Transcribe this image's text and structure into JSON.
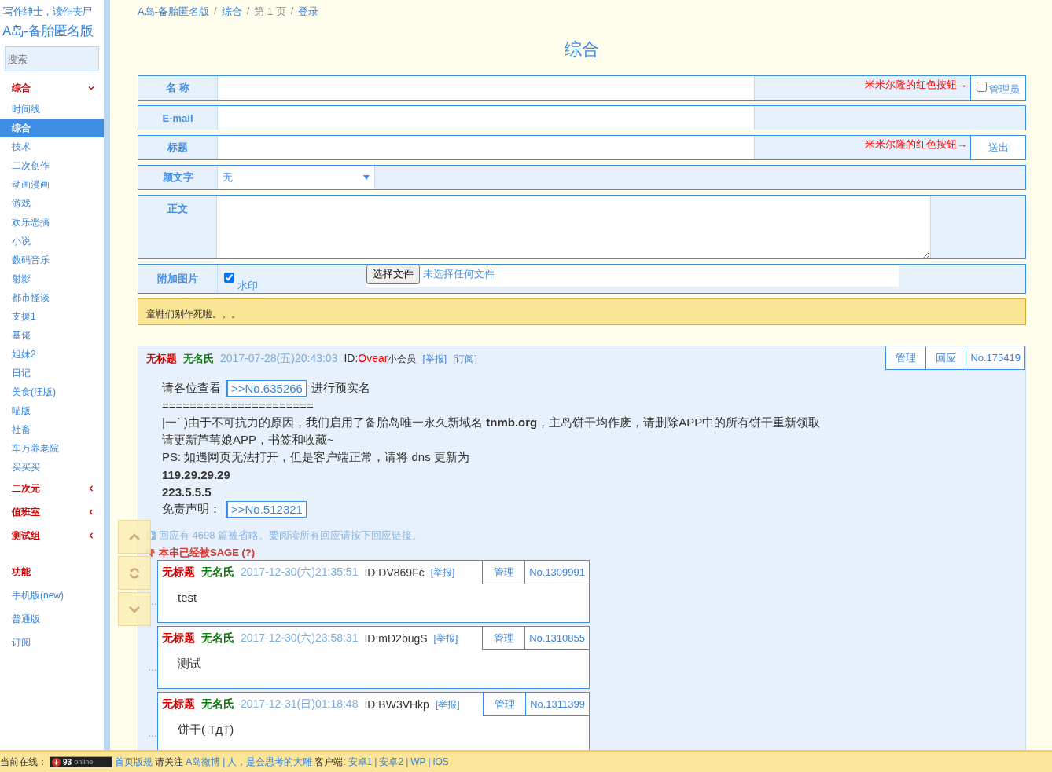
{
  "sidebar": {
    "slogan": "写作绅士，读作丧尸",
    "site_title": "A岛-备胎匿名版",
    "search": {
      "placeholder": "搜索"
    },
    "groups": [
      {
        "label": "综合",
        "expanded": true,
        "items": [
          {
            "label": "时间线",
            "selected": false
          },
          {
            "label": "综合",
            "selected": true
          },
          {
            "label": "技术",
            "selected": false
          },
          {
            "label": "二次创作",
            "selected": false
          },
          {
            "label": "动画漫画",
            "selected": false
          },
          {
            "label": "游戏",
            "selected": false
          },
          {
            "label": "欢乐恶搞",
            "selected": false
          },
          {
            "label": "小说",
            "selected": false
          },
          {
            "label": "数码音乐",
            "selected": false
          },
          {
            "label": "射影",
            "selected": false
          },
          {
            "label": "都市怪谈",
            "selected": false
          },
          {
            "label": "支援1",
            "selected": false
          },
          {
            "label": "基佬",
            "selected": false
          },
          {
            "label": "姐妹2",
            "selected": false
          },
          {
            "label": "日记",
            "selected": false
          },
          {
            "label": "美食(汪版)",
            "selected": false
          },
          {
            "label": "喵版",
            "selected": false
          },
          {
            "label": "社畜",
            "selected": false
          },
          {
            "label": "车万养老院",
            "selected": false
          },
          {
            "label": "买买买",
            "selected": false
          }
        ]
      },
      {
        "label": "二次元",
        "expanded": false
      },
      {
        "label": "值班室",
        "expanded": false
      },
      {
        "label": "测试组",
        "expanded": false
      }
    ],
    "functions": {
      "label": "功能",
      "items": [
        "手机版(new)",
        "普通版",
        "订阅"
      ]
    }
  },
  "breadcrumb": [
    "A岛-备胎匿名版",
    "综合",
    "第 1 页",
    "登录"
  ],
  "breadcrumb_separator": "/",
  "page_title": "综合",
  "form": {
    "name_label": "名 称",
    "email_label": "E-mail",
    "title_label": "标题",
    "red_button_hint": "米米尔隆的红色按钮→",
    "red_button_hint_2": "米米尔隆的红色按钮→",
    "admin": {
      "label": "管理员",
      "checked": false
    },
    "send": "送出",
    "kaomoji_label": "颜文字",
    "kaomoji_value": "无",
    "body_label": "正文",
    "attach_label": "附加图片",
    "watermark": {
      "label": "水印",
      "checked": true
    },
    "file_button": "选择文件",
    "file_status": "未选择任何文件"
  },
  "notice": "童鞋们别作死啦。。。",
  "thread": {
    "title": "无标题",
    "name": "无名氏",
    "time": "2017-07-28(五)20:43:03",
    "id_prefix": "ID:",
    "id": "Ovear",
    "badge": "小会员",
    "links": [
      "[举报]",
      "[订阅]"
    ],
    "actions": [
      "管理",
      "回应"
    ],
    "no": "No.175419",
    "body": [
      [
        {
          "kind": "text",
          "text": "请各位查看"
        },
        {
          "kind": "quote",
          "text": ">>No.635266"
        },
        {
          "kind": "text",
          "text": "进行预实名"
        }
      ],
      [
        {
          "kind": "text",
          "text": "======================"
        }
      ],
      [
        {
          "kind": "text",
          "text": "|一` )由于不可抗力的原因，我们启用了备胎岛唯一永久新域名 **tnmb.org**，主岛饼干均作废，请删除APP中的所有饼干重新领取"
        }
      ],
      [
        {
          "kind": "text",
          "text": "请更新芦苇娘APP，书签和收藏~"
        }
      ],
      [
        {
          "kind": "text",
          "text": "PS: 如遇网页无法打开，但是客户端正常，请将 dns 更新为"
        }
      ],
      [
        {
          "kind": "text",
          "text": "**119.29.29.29**"
        }
      ],
      [
        {
          "kind": "text",
          "text": "**223.5.5.5**"
        }
      ],
      [
        {
          "kind": "text",
          "text": "免责声明："
        },
        {
          "kind": "quote",
          "text": ">>No.512321"
        }
      ]
    ],
    "omitted": "回应有 4698 篇被省略。要阅读所有回应请按下回应链接。",
    "sage": "本串已经被SAGE (?)",
    "replies": [
      {
        "marker": "…",
        "title": "无标题",
        "name": "无名氏",
        "time": "2017-12-30(六)21:35:51",
        "id": "ID:DV869Fc",
        "report": "[举报]",
        "manage": "管理",
        "no": "No.1309991",
        "content": "test"
      },
      {
        "marker": "…",
        "title": "无标题",
        "name": "无名氏",
        "time": "2017-12-30(六)23:58:31",
        "id": "ID:mD2bugS",
        "report": "[举报]",
        "manage": "管理",
        "no": "No.1310855",
        "content": "测试"
      },
      {
        "marker": "…",
        "title": "无标题",
        "name": "无名氏",
        "time": "2017-12-31(日)01:18:48",
        "id": "ID:BW3VHkp",
        "report": "[举报]",
        "manage": "管理",
        "no": "No.1311399",
        "content": "饼干( TдT)"
      }
    ]
  },
  "footer": {
    "online_label": "当前在线：",
    "online_count": "93",
    "online_unit": "online",
    "items": [
      {
        "kind": "link",
        "text": "首页版规"
      },
      {
        "kind": "text",
        "text": "请关注"
      },
      {
        "kind": "link",
        "text": "A岛微博"
      },
      {
        "kind": "link",
        "text": "|"
      },
      {
        "kind": "link",
        "text": "人，是会思考的大雕"
      },
      {
        "kind": "text",
        "text": "客户端:"
      },
      {
        "kind": "link",
        "text": "安卓1"
      },
      {
        "kind": "link",
        "text": "|"
      },
      {
        "kind": "link",
        "text": "安卓2"
      },
      {
        "kind": "link",
        "text": "|"
      },
      {
        "kind": "link",
        "text": "WP"
      },
      {
        "kind": "link",
        "text": "|"
      },
      {
        "kind": "link",
        "text": "iOS"
      }
    ]
  }
}
